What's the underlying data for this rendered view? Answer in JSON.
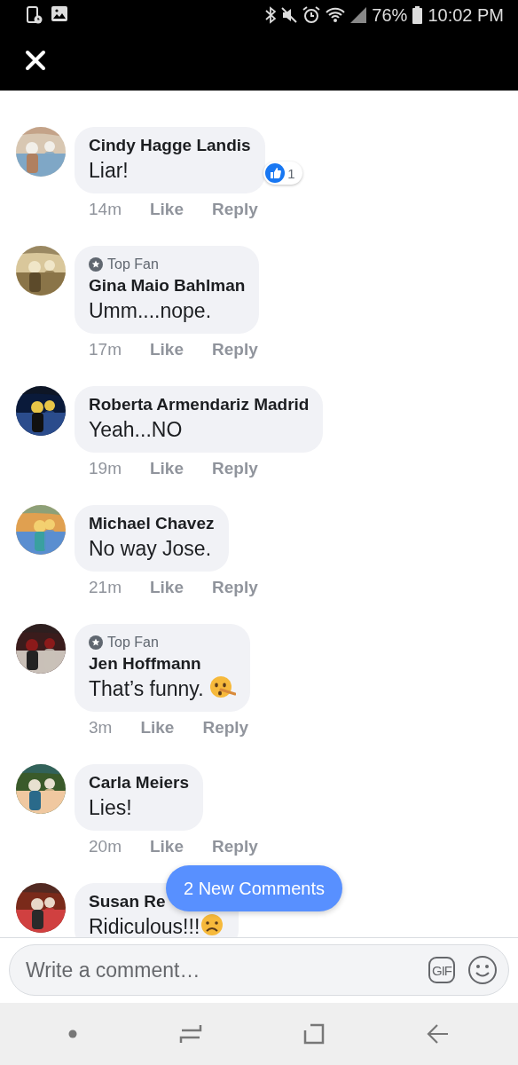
{
  "status_bar": {
    "battery": "76%",
    "time": "10:02 PM"
  },
  "comments": [
    {
      "name": "Cindy Hagge Landis",
      "text": "Liar!",
      "time": "14m",
      "actions": [
        "Like",
        "Reply"
      ],
      "reactions": {
        "count": "1"
      }
    },
    {
      "badge": "Top Fan",
      "name": "Gina Maio Bahlman",
      "text": "Umm....nope.",
      "time": "17m",
      "actions": [
        "Like",
        "Reply"
      ]
    },
    {
      "name": "Roberta Armendariz Madrid",
      "text": "Yeah...NO",
      "time": "19m",
      "actions": [
        "Like",
        "Reply"
      ]
    },
    {
      "name": "Michael Chavez",
      "text": "No way Jose.",
      "time": "21m",
      "actions": [
        "Like",
        "Reply"
      ]
    },
    {
      "badge": "Top Fan",
      "name": "Jen Hoffmann",
      "text": "That’s funny.",
      "emoji": {
        "kind": "lying"
      },
      "time": "3m",
      "actions": [
        "Like",
        "Reply"
      ]
    },
    {
      "name": "Carla Meiers",
      "text": "Lies!",
      "time": "20m",
      "actions": [
        "Like",
        "Reply"
      ]
    },
    {
      "name": "Susan Re",
      "text": "Ridiculous!!!",
      "emoji": {
        "kind": "frown"
      }
    }
  ],
  "new_comments_button": "2 New Comments",
  "composer": {
    "placeholder": "Write a comment…",
    "gif_label": "GIF"
  }
}
